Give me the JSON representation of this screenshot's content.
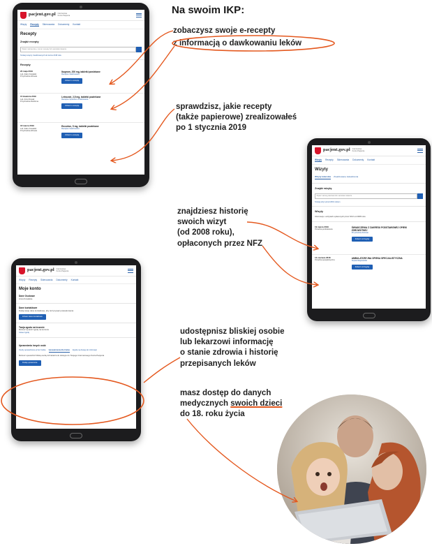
{
  "headline": "Na swoim IKP:",
  "annotations": {
    "prescriptions_1": "zobaczysz swoje e-recepty",
    "prescriptions_2": "z informacją o dawkowaniu leków",
    "paper_1": "sprawdzisz, jakie recepty",
    "paper_2": "(także papierowe) zrealizowałeś",
    "paper_3": "po 1 stycznia 2019",
    "visits_1": "znajdziesz historię",
    "visits_2": "swoich wizyt",
    "visits_3": "(od 2008 roku),",
    "visits_4": "opłaconych przez NFZ",
    "share_1": "udostępnisz bliskiej osobie",
    "share_2": "lub lekarzowi informację",
    "share_3": "o stanie zdrowia i historię",
    "share_4": "przepisanych leków",
    "kids_1": "masz dostęp do danych",
    "kids_2a": "medycznych ",
    "kids_2b": "swoich dzieci",
    "kids_3": "do 18. roku życia"
  },
  "site": {
    "logo": "pacjent.gov.pl",
    "logo_sub": "Internetowe Konto Pacjenta"
  },
  "tablet_prescriptions": {
    "nav": [
      "Wizyty",
      "Recepty",
      "Skierowania",
      "Dokumenty",
      "Kontakt"
    ],
    "title": "Recepty",
    "search_label": "Znajdź recepty",
    "search_placeholder": "Wpisz nazwę leku, numer recepty lub nazwisko lekarza",
    "search_link": "Szukaj recepty zrealizowanych do końca 2018 roku",
    "section": "Recepty",
    "cards": [
      {
        "date": "20 maja 2019",
        "doctor": "Lek. Adam Kowalski",
        "place": "Przychodnia Zdrowie",
        "drug": "Ibuprom, 200 mg, tabletki powlekane",
        "status": "Recepta zrealizowana",
        "button": "Zobacz e-receptę"
      },
      {
        "date": "15 kwietnia 2019",
        "doctor": "Lek. Anna Nowak",
        "place": "Przychodnia Rodzinna",
        "drug": "Letrozole, 2,5 mg, tabletki powlekane",
        "status": "Recepta częściowo zrealizowana",
        "button": "Zobacz e-receptę"
      },
      {
        "date": "18 marca 2019",
        "doctor": "Lek. Adam Kowalski",
        "place": "Przychodnia Zdrowie",
        "drug": "Encorton, 5 mg, tabletki powlekane",
        "status": "Recepta zrealizowana",
        "button": "Zobacz e-receptę"
      }
    ]
  },
  "tablet_visits": {
    "nav": [
      "Wizyty",
      "Recepty",
      "Skierowania",
      "Dokumenty",
      "Kontakt"
    ],
    "title": "Wizyty",
    "tabs": [
      "Wizyty lekarskie",
      "Zrealizowane świadczenia"
    ],
    "search_label": "Znajdź wizytę",
    "search_placeholder": "Wpisz nazwę placówki lub nazwisko lekarza",
    "search_link": "Szukaj wizyt przed 2019 rokiem",
    "section": "Wizyty",
    "section_note": "Informacje o wizytach opłaconych przez NFZ od 2008 roku",
    "cards": [
      {
        "date": "19 marca 2019",
        "place": "Poradnia podstawowa",
        "title": "ŚWIADCZENIA Z ZAKRESU PODSTAWOWEJ OPIEKI ZDROWOTNEJ",
        "info": "Przychodnia Zdrowie",
        "button": "Zobacz szczegóły"
      },
      {
        "date": "13 czerwca 2018",
        "place": "Poradnia specjalistyczna",
        "title": "AMBULATORYJNA OPIEKA SPECJALISTYCZNA",
        "info": "Szpital Wojewódzki",
        "button": "Zobacz szczegóły"
      }
    ]
  },
  "tablet_account": {
    "nav": [
      "Wizyty",
      "Recepty",
      "Skierowania",
      "Dokumenty",
      "Kontakt"
    ],
    "title": "Moje konto",
    "name_label": "Dane Osobowe",
    "name_value": "Anna Kowalska",
    "contact_label": "Dane kontaktowe",
    "contact_text": "Dodaj swoje dane kontaktowe, aby otrzymywać powiadomienia",
    "contact_button": "Zobacz dane kontaktowe",
    "consent_label": "Twoja zgoda na leczenie",
    "consent_text": "Możesz wyrazić zgodę na leczenie",
    "consent_link": "Ustaw zgodę",
    "auth_label": "Uprawnienia innych osób",
    "auth_tabs": [
      "Osoby upoważnione przez Ciebie",
      "Upoważnienia dla Ciebie",
      "Zgoda na dostęp do informacji"
    ],
    "auth_text": "Możesz upoważnić bliską osobę lub lekarza do dostępu do Twojego Internetowego Konta Pacjenta",
    "auth_button": "Dodaj uprawnienie"
  },
  "colors": {
    "accent": "#e4581e",
    "button_blue": "#1f5fb4",
    "logo_red": "#d7142b"
  }
}
